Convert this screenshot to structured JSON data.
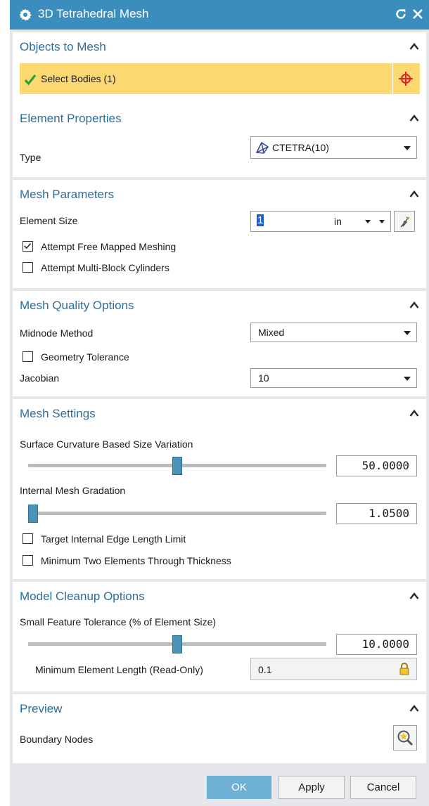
{
  "dialog": {
    "title": "3D Tetrahedral Mesh"
  },
  "objects_to_mesh": {
    "title": "Objects to Mesh",
    "select_bodies_label": "Select Bodies (1)"
  },
  "element_properties": {
    "title": "Element Properties",
    "type_label": "Type",
    "type_value": "CTETRA(10)"
  },
  "mesh_parameters": {
    "title": "Mesh Parameters",
    "element_size_label": "Element Size",
    "element_size_value": "1",
    "element_size_unit": "in",
    "free_mapped_label": "Attempt Free Mapped Meshing",
    "free_mapped_checked": true,
    "multi_block_label": "Attempt Multi-Block Cylinders",
    "multi_block_checked": false
  },
  "mesh_quality": {
    "title": "Mesh Quality Options",
    "midnode_label": "Midnode Method",
    "midnode_value": "Mixed",
    "geometry_tolerance_label": "Geometry Tolerance",
    "geometry_tolerance_checked": false,
    "jacobian_label": "Jacobian",
    "jacobian_value": "10"
  },
  "mesh_settings": {
    "title": "Mesh Settings",
    "surface_curvature_label": "Surface Curvature Based Size Variation",
    "surface_curvature_value": "50.0000",
    "surface_curvature_fraction": 0.5,
    "internal_gradation_label": "Internal Mesh Gradation",
    "internal_gradation_value": "1.0500",
    "internal_gradation_fraction": 0.0,
    "target_edge_label": "Target Internal Edge Length Limit",
    "target_edge_checked": false,
    "min_two_elements_label": "Minimum Two Elements Through Thickness",
    "min_two_elements_checked": false
  },
  "model_cleanup": {
    "title": "Model Cleanup Options",
    "small_feature_label": "Small Feature Tolerance (% of Element Size)",
    "small_feature_value": "10.0000",
    "small_feature_fraction": 0.5,
    "min_element_length_label": "Minimum Element Length (Read-Only)",
    "min_element_length_value": "0.1"
  },
  "preview": {
    "title": "Preview",
    "boundary_nodes_label": "Boundary Nodes"
  },
  "buttons": {
    "ok": "OK",
    "apply": "Apply",
    "cancel": "Cancel"
  },
  "colors": {
    "titlebar": "#3b8dbd",
    "section_title": "#2a6f9e",
    "selection_highlight": "#fbd872",
    "ok_button": "#6fb0d6"
  },
  "icons": {
    "title": "gear-icon",
    "reset": "reset-icon",
    "close": "close-icon",
    "select_ok": "green-check-icon",
    "crosshair": "crosshair-icon",
    "element_type": "tetra-icon",
    "size_assist": "lightning-pen-icon",
    "lock": "lock-icon",
    "boundary_nodes": "magnifier-star-icon"
  }
}
